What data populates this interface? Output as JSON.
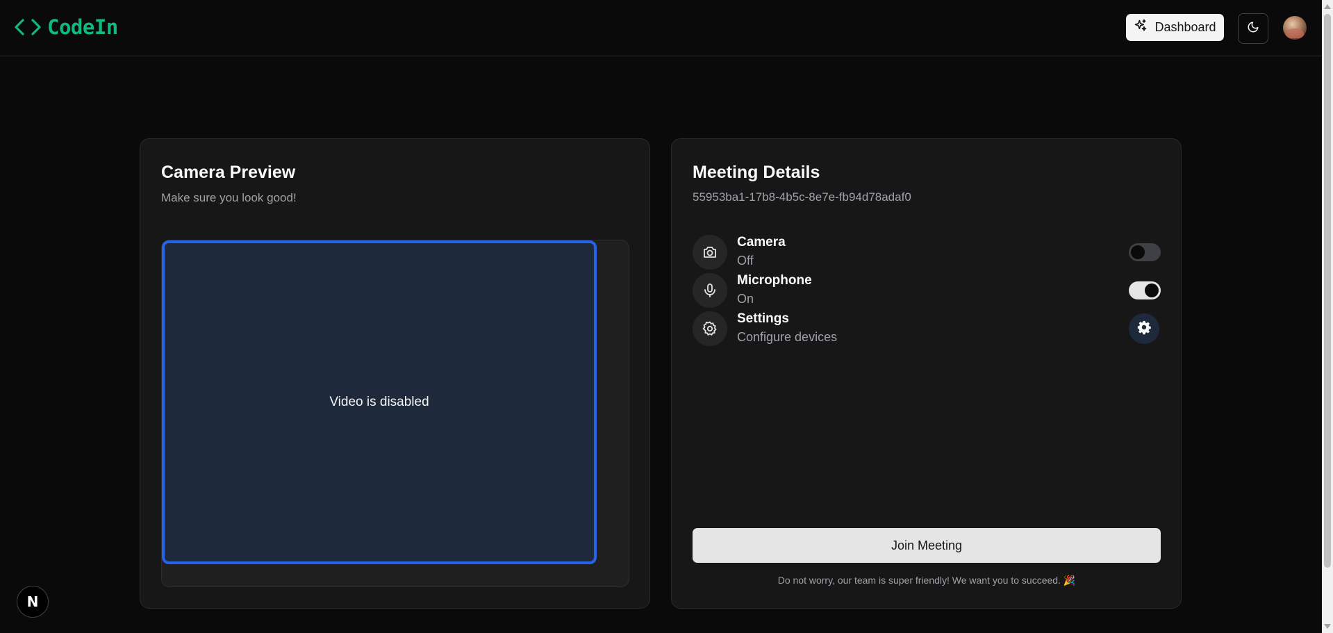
{
  "header": {
    "logo_text": "CodeIn",
    "logo_icon": "code-brackets-icon",
    "dashboard_label": "Dashboard",
    "dashboard_icon": "sparkles-icon",
    "theme_icon": "moon-icon",
    "avatar": "user-avatar"
  },
  "preview": {
    "title": "Camera Preview",
    "subtitle": "Make sure you look good!",
    "video_status": "Video is disabled"
  },
  "meeting": {
    "title": "Meeting Details",
    "meeting_id": "55953ba1-17b8-4b5c-8e7e-fb94d78adaf0",
    "settings": [
      {
        "label": "Camera",
        "status": "Off",
        "icon": "camera-icon",
        "control": "toggle",
        "enabled": false
      },
      {
        "label": "Microphone",
        "status": "On",
        "icon": "microphone-icon",
        "control": "toggle",
        "enabled": true
      },
      {
        "label": "Settings",
        "status": "Configure devices",
        "icon": "gear-icon",
        "control": "button"
      }
    ],
    "join_label": "Join Meeting",
    "join_note": "Do not worry, our team is super friendly! We want you to succeed. 🎉"
  },
  "dev_badge": {
    "label": "N"
  },
  "colors": {
    "brand": "#10b981",
    "video_border": "#2563eb",
    "video_bg": "#1e293b",
    "background": "#0a0a0a",
    "card": "#171717"
  }
}
